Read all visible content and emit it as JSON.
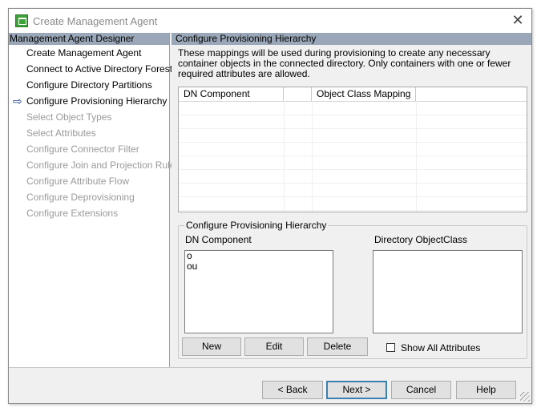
{
  "window": {
    "title": "Create Management Agent",
    "close_glyph": "✕",
    "app_icon": "management-agent-icon"
  },
  "left_pane": {
    "header": "Management Agent Designer",
    "current_glyph": "⇨",
    "items": [
      {
        "label": "Create Management Agent",
        "state": "enabled"
      },
      {
        "label": "Connect to Active Directory Forest",
        "state": "enabled"
      },
      {
        "label": "Configure Directory Partitions",
        "state": "enabled"
      },
      {
        "label": "Configure Provisioning Hierarchy",
        "state": "current"
      },
      {
        "label": "Select Object Types",
        "state": "disabled"
      },
      {
        "label": "Select Attributes",
        "state": "disabled"
      },
      {
        "label": "Configure Connector Filter",
        "state": "disabled"
      },
      {
        "label": "Configure Join and Projection Rules",
        "state": "disabled"
      },
      {
        "label": "Configure Attribute Flow",
        "state": "disabled"
      },
      {
        "label": "Configure Deprovisioning",
        "state": "disabled"
      },
      {
        "label": "Configure Extensions",
        "state": "disabled"
      }
    ]
  },
  "right_pane": {
    "header": "Configure Provisioning Hierarchy",
    "description": "These mappings will be used during provisioning to create any necessary container objects in the connected directory.  Only containers with one or fewer required attributes are allowed.",
    "mapping_table": {
      "columns": [
        "DN Component",
        "",
        "Object Class Mapping",
        ""
      ],
      "rows": []
    },
    "group": {
      "legend": "Configure Provisioning Hierarchy",
      "dn_component_label": "DN Component",
      "dn_component_items": [
        "o",
        "ou"
      ],
      "object_class_label": "Directory ObjectClass",
      "object_class_items": [],
      "new_label": "New",
      "edit_label": "Edit",
      "delete_label": "Delete",
      "show_all_label": "Show All Attributes",
      "show_all_checked": false
    }
  },
  "footer": {
    "back_label": "< Back",
    "next_label": "Next >",
    "cancel_label": "Cancel",
    "help_label": "Help"
  }
}
